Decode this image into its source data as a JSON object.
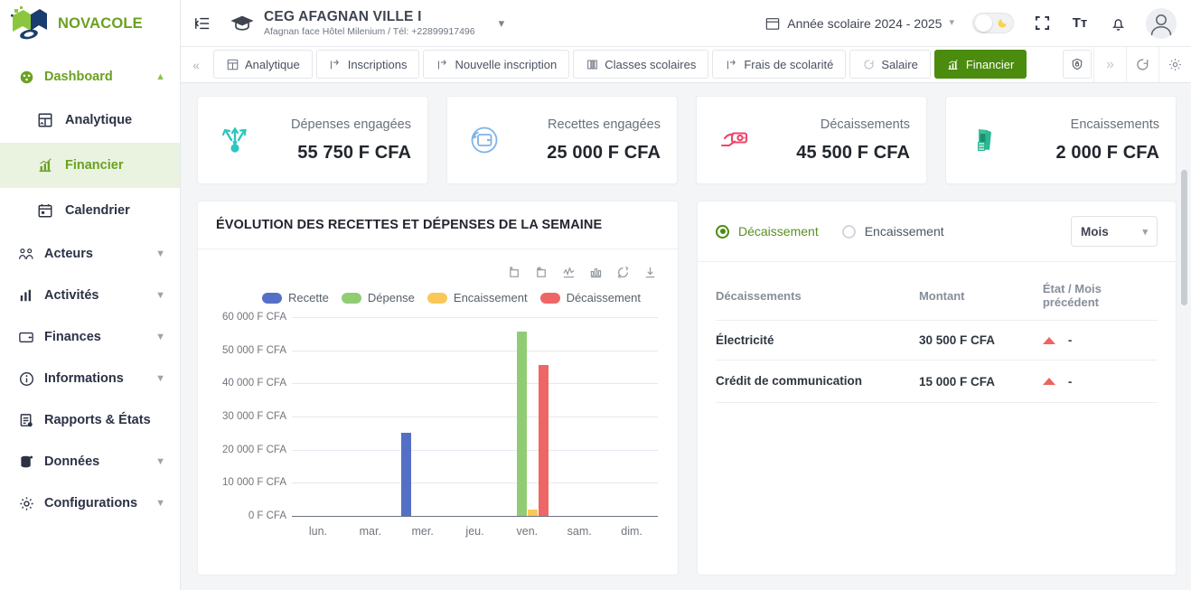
{
  "brand": {
    "name": "NOVACOLE",
    "logo_icon": "book-logo-icon"
  },
  "sidebar": {
    "dashboard": {
      "label": "Dashboard",
      "icon": "dashboard-icon",
      "chevron": "chevron-up-icon"
    },
    "sub_items": [
      {
        "label": "Analytique",
        "icon": "analytics-icon"
      },
      {
        "label": "Financier",
        "icon": "bar-chart-icon"
      },
      {
        "label": "Calendrier",
        "icon": "calendar-icon"
      }
    ],
    "groups": [
      {
        "label": "Acteurs",
        "icon": "people-icon",
        "chevron": "chevron-down-icon"
      },
      {
        "label": "Activités",
        "icon": "chart-bars-icon",
        "chevron": "chevron-down-icon"
      },
      {
        "label": "Finances",
        "icon": "wallet-icon",
        "chevron": "chevron-down-icon"
      },
      {
        "label": "Informations",
        "icon": "info-circle-icon",
        "chevron": "chevron-down-icon"
      },
      {
        "label": "Rapports & États",
        "icon": "report-icon",
        "chevron": ""
      },
      {
        "label": "Données",
        "icon": "database-icon",
        "chevron": "chevron-down-icon"
      },
      {
        "label": "Configurations",
        "icon": "gear-icon",
        "chevron": "chevron-down-icon"
      }
    ]
  },
  "topbar": {
    "collapse_icon": "sidebar-collapse-icon",
    "school_icon": "graduation-cap-icon",
    "school_name": "CEG AFAGNAN VILLE I",
    "school_sub": "Afagnan face Hôtel Milenium / Tél: +22899917496",
    "school_chevron": "chevron-down-icon",
    "year_label": "Année scolaire 2024 - 2025",
    "year_icon": "calendar-icon",
    "year_chevron": "chevron-down-icon",
    "theme_toggle_icon": "moon-icon",
    "fullscreen_icon": "fullscreen-icon",
    "textsize_icon": "text-size-icon",
    "textsize_label": "Tт",
    "bell_icon": "bell-icon",
    "avatar_icon": "user-avatar-icon"
  },
  "tabs": {
    "prev_icon": "chevron-double-left-icon",
    "next_icon": "chevron-double-right-icon",
    "items": [
      {
        "label": "Analytique",
        "icon": "analytics-icon",
        "active": false
      },
      {
        "label": "Inscriptions",
        "icon": "enrollment-icon",
        "active": false
      },
      {
        "label": "Nouvelle inscription",
        "icon": "enrollment-icon",
        "active": false
      },
      {
        "label": "Classes scolaires",
        "icon": "classes-icon",
        "active": false
      },
      {
        "label": "Frais de scolarité",
        "icon": "enrollment-icon",
        "active": false
      },
      {
        "label": "Salaire",
        "icon": "salary-icon",
        "active": false
      },
      {
        "label": "Financier",
        "icon": "bar-chart-icon",
        "active": true
      }
    ],
    "tools": [
      {
        "icon": "lock-shield-icon"
      },
      {
        "icon": "chevron-double-right-icon"
      },
      {
        "icon": "refresh-icon"
      },
      {
        "icon": "gear-icon"
      }
    ]
  },
  "stat_cards": [
    {
      "label": "Dépenses engagées",
      "value": "55 750 F CFA",
      "icon": "expenses-arrows-icon",
      "color": "#2fc6c0"
    },
    {
      "label": "Recettes engagées",
      "value": "25 000 F CFA",
      "icon": "wallet-refresh-icon",
      "color": "#7fb3e8"
    },
    {
      "label": "Décaissements",
      "value": "45 500 F CFA",
      "icon": "hand-money-icon",
      "color": "#f0456a"
    },
    {
      "label": "Encaissements",
      "value": "2 000 F CFA",
      "icon": "cash-bundle-icon",
      "color": "#2bb894"
    }
  ],
  "chart_panel": {
    "title": "ÉVOLUTION DES RECETTES ET DÉPENSES DE LA SEMAINE",
    "toolbar_icons": [
      "zoom-select-icon",
      "zoom-reset-icon",
      "line-chart-icon",
      "bar-chart-icon",
      "restore-icon",
      "download-icon"
    ]
  },
  "chart_data": {
    "type": "bar",
    "title": "ÉVOLUTION DES RECETTES ET DÉPENSES DE LA SEMAINE",
    "xlabel": "",
    "ylabel": "",
    "categories": [
      "lun.",
      "mar.",
      "mer.",
      "jeu.",
      "ven.",
      "sam.",
      "dim."
    ],
    "ylim": [
      0,
      60000
    ],
    "yticks": [
      0,
      10000,
      20000,
      30000,
      40000,
      50000,
      60000
    ],
    "ytick_labels": [
      "0 F CFA",
      "10 000 F CFA",
      "20 000 F CFA",
      "30 000 F CFA",
      "40 000 F CFA",
      "50 000 F CFA",
      "60 000 F CFA"
    ],
    "grid": true,
    "legend_position": "top",
    "series": [
      {
        "name": "Recette",
        "color": "#5470c6",
        "values": [
          0,
          0,
          25000,
          0,
          0,
          0,
          0
        ]
      },
      {
        "name": "Dépense",
        "color": "#91cc75",
        "values": [
          0,
          0,
          0,
          0,
          55750,
          0,
          0
        ]
      },
      {
        "name": "Encaissement",
        "color": "#fac858",
        "values": [
          0,
          0,
          0,
          0,
          2000,
          0,
          0
        ]
      },
      {
        "name": "Décaissement",
        "color": "#ee6666",
        "values": [
          0,
          0,
          0,
          0,
          45500,
          0,
          0
        ]
      }
    ]
  },
  "right_panel": {
    "radio_decaissement": "Décaissement",
    "radio_encaissement": "Encaissement",
    "period_value": "Mois",
    "period_chevron": "chevron-down-icon",
    "columns": [
      "Décaissements",
      "Montant",
      "État / Mois précédent"
    ],
    "rows": [
      {
        "name": "Électricité",
        "amount": "30 500 F CFA",
        "trend_icon": "triangle-up-icon",
        "state": "-"
      },
      {
        "name": "Crédit de communication",
        "amount": "15 000 F CFA",
        "trend_icon": "triangle-up-icon",
        "state": "-"
      }
    ]
  },
  "colors": {
    "brand_green": "#6aa121",
    "active_tab": "#4b8b0e",
    "sidebar_selected_bg": "#eaf3e0",
    "page_bg": "#f4f5f7"
  }
}
